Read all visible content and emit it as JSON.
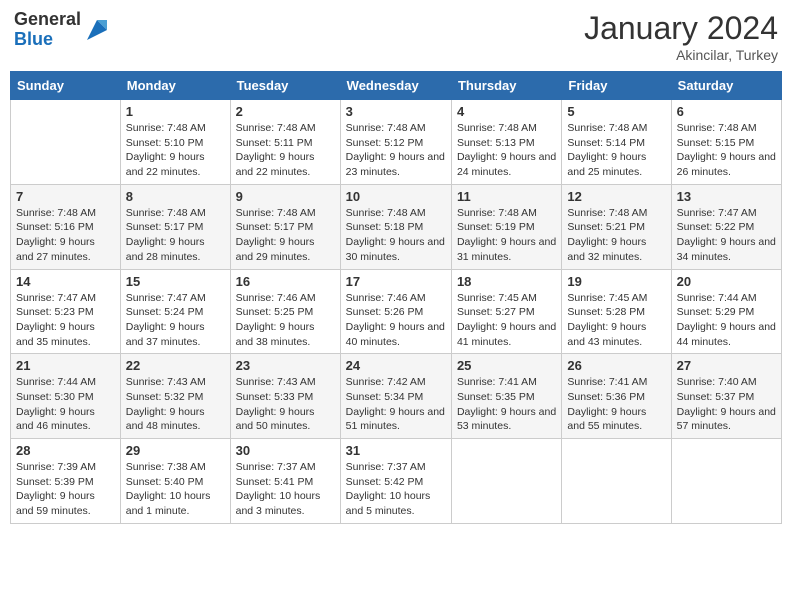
{
  "header": {
    "logo_line1": "General",
    "logo_line2": "Blue",
    "month": "January 2024",
    "location": "Akincilar, Turkey"
  },
  "weekdays": [
    "Sunday",
    "Monday",
    "Tuesday",
    "Wednesday",
    "Thursday",
    "Friday",
    "Saturday"
  ],
  "weeks": [
    [
      {
        "day": "",
        "sunrise": "",
        "sunset": "",
        "daylight": ""
      },
      {
        "day": "1",
        "sunrise": "Sunrise: 7:48 AM",
        "sunset": "Sunset: 5:10 PM",
        "daylight": "Daylight: 9 hours and 22 minutes."
      },
      {
        "day": "2",
        "sunrise": "Sunrise: 7:48 AM",
        "sunset": "Sunset: 5:11 PM",
        "daylight": "Daylight: 9 hours and 22 minutes."
      },
      {
        "day": "3",
        "sunrise": "Sunrise: 7:48 AM",
        "sunset": "Sunset: 5:12 PM",
        "daylight": "Daylight: 9 hours and 23 minutes."
      },
      {
        "day": "4",
        "sunrise": "Sunrise: 7:48 AM",
        "sunset": "Sunset: 5:13 PM",
        "daylight": "Daylight: 9 hours and 24 minutes."
      },
      {
        "day": "5",
        "sunrise": "Sunrise: 7:48 AM",
        "sunset": "Sunset: 5:14 PM",
        "daylight": "Daylight: 9 hours and 25 minutes."
      },
      {
        "day": "6",
        "sunrise": "Sunrise: 7:48 AM",
        "sunset": "Sunset: 5:15 PM",
        "daylight": "Daylight: 9 hours and 26 minutes."
      }
    ],
    [
      {
        "day": "7",
        "sunrise": "Sunrise: 7:48 AM",
        "sunset": "Sunset: 5:16 PM",
        "daylight": "Daylight: 9 hours and 27 minutes."
      },
      {
        "day": "8",
        "sunrise": "Sunrise: 7:48 AM",
        "sunset": "Sunset: 5:17 PM",
        "daylight": "Daylight: 9 hours and 28 minutes."
      },
      {
        "day": "9",
        "sunrise": "Sunrise: 7:48 AM",
        "sunset": "Sunset: 5:17 PM",
        "daylight": "Daylight: 9 hours and 29 minutes."
      },
      {
        "day": "10",
        "sunrise": "Sunrise: 7:48 AM",
        "sunset": "Sunset: 5:18 PM",
        "daylight": "Daylight: 9 hours and 30 minutes."
      },
      {
        "day": "11",
        "sunrise": "Sunrise: 7:48 AM",
        "sunset": "Sunset: 5:19 PM",
        "daylight": "Daylight: 9 hours and 31 minutes."
      },
      {
        "day": "12",
        "sunrise": "Sunrise: 7:48 AM",
        "sunset": "Sunset: 5:21 PM",
        "daylight": "Daylight: 9 hours and 32 minutes."
      },
      {
        "day": "13",
        "sunrise": "Sunrise: 7:47 AM",
        "sunset": "Sunset: 5:22 PM",
        "daylight": "Daylight: 9 hours and 34 minutes."
      }
    ],
    [
      {
        "day": "14",
        "sunrise": "Sunrise: 7:47 AM",
        "sunset": "Sunset: 5:23 PM",
        "daylight": "Daylight: 9 hours and 35 minutes."
      },
      {
        "day": "15",
        "sunrise": "Sunrise: 7:47 AM",
        "sunset": "Sunset: 5:24 PM",
        "daylight": "Daylight: 9 hours and 37 minutes."
      },
      {
        "day": "16",
        "sunrise": "Sunrise: 7:46 AM",
        "sunset": "Sunset: 5:25 PM",
        "daylight": "Daylight: 9 hours and 38 minutes."
      },
      {
        "day": "17",
        "sunrise": "Sunrise: 7:46 AM",
        "sunset": "Sunset: 5:26 PM",
        "daylight": "Daylight: 9 hours and 40 minutes."
      },
      {
        "day": "18",
        "sunrise": "Sunrise: 7:45 AM",
        "sunset": "Sunset: 5:27 PM",
        "daylight": "Daylight: 9 hours and 41 minutes."
      },
      {
        "day": "19",
        "sunrise": "Sunrise: 7:45 AM",
        "sunset": "Sunset: 5:28 PM",
        "daylight": "Daylight: 9 hours and 43 minutes."
      },
      {
        "day": "20",
        "sunrise": "Sunrise: 7:44 AM",
        "sunset": "Sunset: 5:29 PM",
        "daylight": "Daylight: 9 hours and 44 minutes."
      }
    ],
    [
      {
        "day": "21",
        "sunrise": "Sunrise: 7:44 AM",
        "sunset": "Sunset: 5:30 PM",
        "daylight": "Daylight: 9 hours and 46 minutes."
      },
      {
        "day": "22",
        "sunrise": "Sunrise: 7:43 AM",
        "sunset": "Sunset: 5:32 PM",
        "daylight": "Daylight: 9 hours and 48 minutes."
      },
      {
        "day": "23",
        "sunrise": "Sunrise: 7:43 AM",
        "sunset": "Sunset: 5:33 PM",
        "daylight": "Daylight: 9 hours and 50 minutes."
      },
      {
        "day": "24",
        "sunrise": "Sunrise: 7:42 AM",
        "sunset": "Sunset: 5:34 PM",
        "daylight": "Daylight: 9 hours and 51 minutes."
      },
      {
        "day": "25",
        "sunrise": "Sunrise: 7:41 AM",
        "sunset": "Sunset: 5:35 PM",
        "daylight": "Daylight: 9 hours and 53 minutes."
      },
      {
        "day": "26",
        "sunrise": "Sunrise: 7:41 AM",
        "sunset": "Sunset: 5:36 PM",
        "daylight": "Daylight: 9 hours and 55 minutes."
      },
      {
        "day": "27",
        "sunrise": "Sunrise: 7:40 AM",
        "sunset": "Sunset: 5:37 PM",
        "daylight": "Daylight: 9 hours and 57 minutes."
      }
    ],
    [
      {
        "day": "28",
        "sunrise": "Sunrise: 7:39 AM",
        "sunset": "Sunset: 5:39 PM",
        "daylight": "Daylight: 9 hours and 59 minutes."
      },
      {
        "day": "29",
        "sunrise": "Sunrise: 7:38 AM",
        "sunset": "Sunset: 5:40 PM",
        "daylight": "Daylight: 10 hours and 1 minute."
      },
      {
        "day": "30",
        "sunrise": "Sunrise: 7:37 AM",
        "sunset": "Sunset: 5:41 PM",
        "daylight": "Daylight: 10 hours and 3 minutes."
      },
      {
        "day": "31",
        "sunrise": "Sunrise: 7:37 AM",
        "sunset": "Sunset: 5:42 PM",
        "daylight": "Daylight: 10 hours and 5 minutes."
      },
      {
        "day": "",
        "sunrise": "",
        "sunset": "",
        "daylight": ""
      },
      {
        "day": "",
        "sunrise": "",
        "sunset": "",
        "daylight": ""
      },
      {
        "day": "",
        "sunrise": "",
        "sunset": "",
        "daylight": ""
      }
    ]
  ]
}
